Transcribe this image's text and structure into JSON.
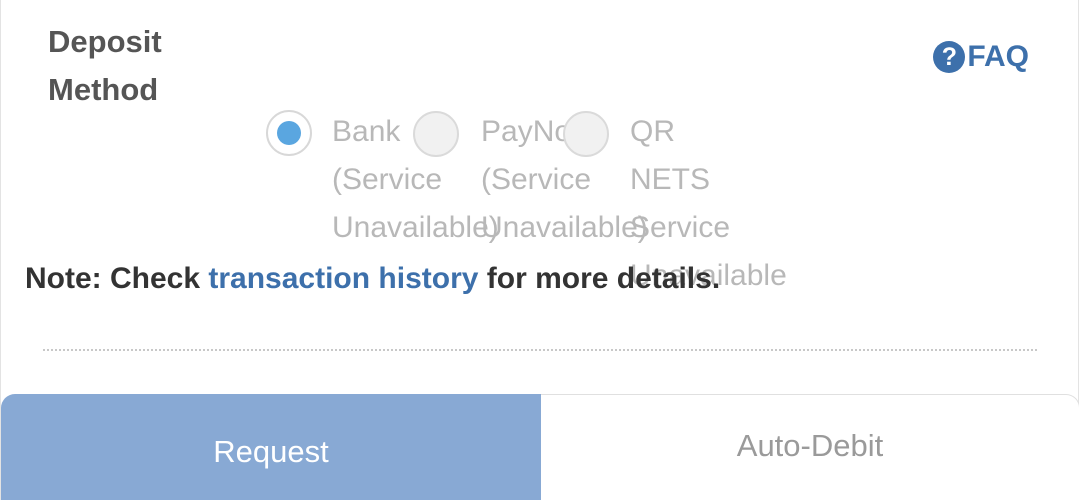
{
  "deposit": {
    "label": "Deposit Method"
  },
  "faq": {
    "icon": "question-circle-icon",
    "label": "FAQ",
    "color": "#3d70ab"
  },
  "methods": [
    {
      "label": "Bank\n(Service\nUnavailable)",
      "selected": true
    },
    {
      "label": "PayNow\n(Service\nUnavailable)",
      "selected": false
    },
    {
      "label": "QR\nNETS\nService\nUnavailable",
      "selected": false
    }
  ],
  "note": {
    "prefix": "Note: Check ",
    "link": "transaction history",
    "suffix": " for more details."
  },
  "actions": {
    "request_label": "Request",
    "auto_debit_label": "Auto-Debit",
    "request_color": "#88a9d4"
  }
}
